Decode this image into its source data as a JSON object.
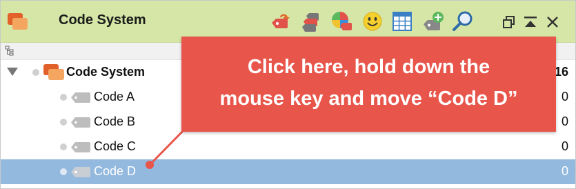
{
  "window": {
    "title": "Code System",
    "buttons": {
      "restore": "restore-window",
      "minimize": "minimize-window",
      "close": "close-window"
    }
  },
  "toolbar": {
    "icons": [
      "undo-code-icon",
      "code-hierarchy-icon",
      "code-colors-icon",
      "emoticon-icon",
      "table-grid-icon",
      "add-code-icon",
      "search-icon"
    ]
  },
  "tree": {
    "root": {
      "label": "Code System",
      "count": "16",
      "expanded": true
    },
    "items": [
      {
        "label": "Code A",
        "count": "0",
        "selected": false
      },
      {
        "label": "Code B",
        "count": "0",
        "selected": false
      },
      {
        "label": "Code C",
        "count": "0",
        "selected": false
      },
      {
        "label": "Code D",
        "count": "0",
        "selected": true
      }
    ]
  },
  "callout": {
    "line1": "Click here, hold down the",
    "line2": "mouse key and move “Code D”"
  },
  "colors": {
    "header_bg": "#d6e6a6",
    "selection_bg": "#93b9de",
    "callout_bg": "#e8554a",
    "tag_gray": "#bdbdbd",
    "tag_orange": "#f08a2e",
    "tag_red": "#e0524a"
  }
}
